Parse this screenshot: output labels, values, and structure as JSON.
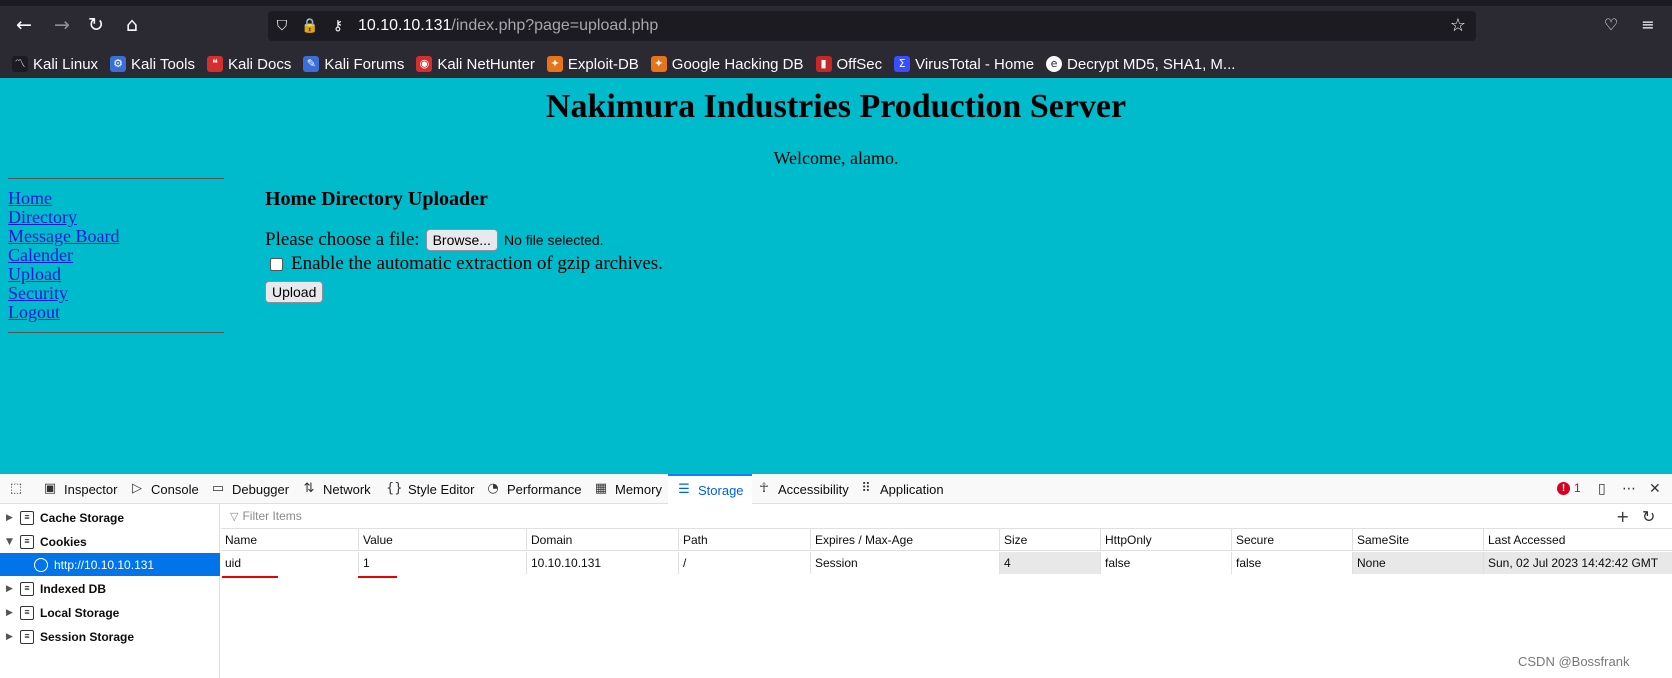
{
  "browser": {
    "url_host": "10.10.10.131",
    "url_path": "/index.php?page=upload.php",
    "bookmarks": [
      {
        "label": "Kali Linux",
        "color": "#1c1b22",
        "icon": "kali-dragon-icon"
      },
      {
        "label": "Kali Tools",
        "color": "#3a6fd8",
        "icon": "kali-tools-icon"
      },
      {
        "label": "Kali Docs",
        "color": "#d32f2f",
        "icon": "kali-docs-icon"
      },
      {
        "label": "Kali Forums",
        "color": "#3a6fd8",
        "icon": "kali-forums-icon"
      },
      {
        "label": "Kali NetHunter",
        "color": "#d32f2f",
        "icon": "nethunter-icon"
      },
      {
        "label": "Exploit-DB",
        "color": "#e8741a",
        "icon": "exploit-db-icon"
      },
      {
        "label": "Google Hacking DB",
        "color": "#e8741a",
        "icon": "ghdb-icon"
      },
      {
        "label": "OffSec",
        "color": "#c62828",
        "icon": "offsec-icon"
      },
      {
        "label": "VirusTotal - Home",
        "color": "#394eff",
        "icon": "virustotal-icon"
      },
      {
        "label": "Decrypt MD5, SHA1, M...",
        "color": "#fbfbfe",
        "icon": "decrypt-icon"
      }
    ]
  },
  "page": {
    "title": "Nakimura Industries Production Server",
    "welcome": "Welcome, alamo.",
    "nav": [
      "Home",
      "Directory",
      "Message Board",
      "Calender",
      "Upload",
      "Security",
      "Logout"
    ],
    "uploader": {
      "heading": "Home Directory Uploader",
      "choose_label": "Please choose a file:",
      "browse_label": "Browse...",
      "no_file": "No file selected.",
      "checkbox_label": "Enable the automatic extraction of gzip archives.",
      "upload_label": "Upload"
    },
    "bg_color": "#00bbcc"
  },
  "devtools": {
    "tabs": [
      {
        "label": "Inspector",
        "icon": "inspector-icon"
      },
      {
        "label": "Console",
        "icon": "console-icon"
      },
      {
        "label": "Debugger",
        "icon": "debugger-icon"
      },
      {
        "label": "Network",
        "icon": "network-icon"
      },
      {
        "label": "Style Editor",
        "icon": "style-editor-icon"
      },
      {
        "label": "Performance",
        "icon": "performance-icon"
      },
      {
        "label": "Memory",
        "icon": "memory-icon"
      },
      {
        "label": "Storage",
        "icon": "storage-icon"
      },
      {
        "label": "Accessibility",
        "icon": "accessibility-icon"
      },
      {
        "label": "Application",
        "icon": "application-icon"
      }
    ],
    "active_tab": "Storage",
    "error_count": "1",
    "sidebar": {
      "cache_storage": "Cache Storage",
      "cookies": "Cookies",
      "cookie_host": "http://10.10.10.131",
      "indexed_db": "Indexed DB",
      "local_storage": "Local Storage",
      "session_storage": "Session Storage"
    },
    "filter_placeholder": "Filter Items",
    "columns": [
      "Name",
      "Value",
      "Domain",
      "Path",
      "Expires / Max-Age",
      "Size",
      "HttpOnly",
      "Secure",
      "SameSite",
      "Last Accessed"
    ],
    "rows": [
      [
        "uid",
        "1",
        "10.10.10.131",
        "/",
        "Session",
        "4",
        "false",
        "false",
        "None",
        "Sun, 02 Jul 2023 14:42:42 GMT"
      ]
    ]
  },
  "watermark": "CSDN @Bossfrank"
}
